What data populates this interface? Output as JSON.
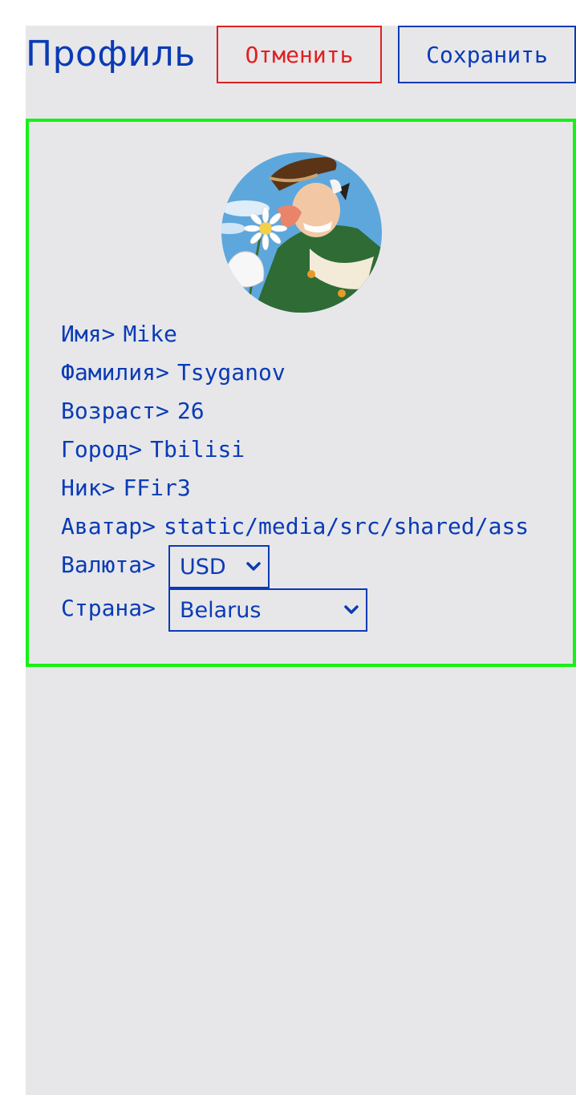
{
  "header": {
    "title": "Профиль",
    "cancel_label": "Отменить",
    "save_label": "Сохранить"
  },
  "profile": {
    "avatar_icon": "avatar-image",
    "fields": {
      "first_name": {
        "label": "Имя>",
        "value": "Mike"
      },
      "last_name": {
        "label": "Фамилия>",
        "value": "Tsyganov"
      },
      "age": {
        "label": "Возраст>",
        "value": "26"
      },
      "city": {
        "label": "Город>",
        "value": "Tbilisi"
      },
      "nickname": {
        "label": "Ник>",
        "value": "FFir3"
      },
      "avatar": {
        "label": "Аватар>",
        "value": "static/media/src/shared/ass"
      }
    },
    "currency": {
      "label": "Валюта>",
      "selected": "USD"
    },
    "country": {
      "label": "Страна>",
      "selected": "Belarus"
    }
  },
  "colors": {
    "accent": "#0a3bb5",
    "cancel": "#e02020",
    "card_border": "#16f116",
    "page_bg": "#e7e7ea"
  }
}
